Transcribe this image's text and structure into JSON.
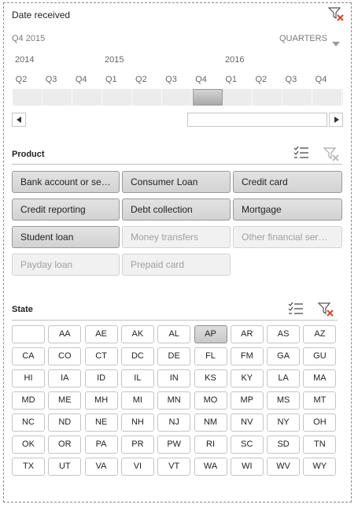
{
  "timeline": {
    "title": "Date received",
    "selection_label": "Q4 2015",
    "level_label": "QUARTERS",
    "years": [
      "2014",
      "2015",
      "2016"
    ],
    "quarters": [
      "Q2",
      "Q3",
      "Q4",
      "Q1",
      "Q2",
      "Q3",
      "Q4",
      "Q1",
      "Q2",
      "Q3",
      "Q4"
    ],
    "selected_index": 6
  },
  "product": {
    "title": "Product",
    "items": [
      {
        "label": "Bank account or se…",
        "state": "selected"
      },
      {
        "label": "Consumer Loan",
        "state": "selected"
      },
      {
        "label": "Credit card",
        "state": "selected"
      },
      {
        "label": "Credit reporting",
        "state": "selected"
      },
      {
        "label": "Debt collection",
        "state": "selected"
      },
      {
        "label": "Mortgage",
        "state": "selected"
      },
      {
        "label": "Student loan",
        "state": "selected"
      },
      {
        "label": "Money transfers",
        "state": "disabled"
      },
      {
        "label": "Other financial ser…",
        "state": "disabled"
      },
      {
        "label": "Payday loan",
        "state": "disabled"
      },
      {
        "label": "Prepaid card",
        "state": "disabled"
      }
    ]
  },
  "state": {
    "title": "State",
    "items": [
      "",
      "AA",
      "AE",
      "AK",
      "AL",
      "AP",
      "AR",
      "AS",
      "AZ",
      "CA",
      "CO",
      "CT",
      "DC",
      "DE",
      "FL",
      "FM",
      "GA",
      "GU",
      "HI",
      "IA",
      "ID",
      "IL",
      "IN",
      "KS",
      "KY",
      "LA",
      "MA",
      "MD",
      "ME",
      "MH",
      "MI",
      "MN",
      "MO",
      "MP",
      "MS",
      "MT",
      "NC",
      "ND",
      "NE",
      "NH",
      "NJ",
      "NM",
      "NV",
      "NY",
      "OH",
      "OK",
      "OR",
      "PA",
      "PR",
      "PW",
      "RI",
      "SC",
      "SD",
      "TN",
      "TX",
      "UT",
      "VA",
      "VI",
      "VT",
      "WA",
      "WI",
      "WV",
      "WY"
    ],
    "selected": "AP"
  },
  "icons": {
    "clear_filter": "clear-filter-icon",
    "multi_select": "multi-select-icon",
    "dropdown": "chevron-down-icon",
    "scroll_left": "scroll-left-icon",
    "scroll_right": "scroll-right-icon"
  },
  "colors": {
    "clear_x": "#d9442b",
    "selected_bar": "#b3b3b3"
  }
}
